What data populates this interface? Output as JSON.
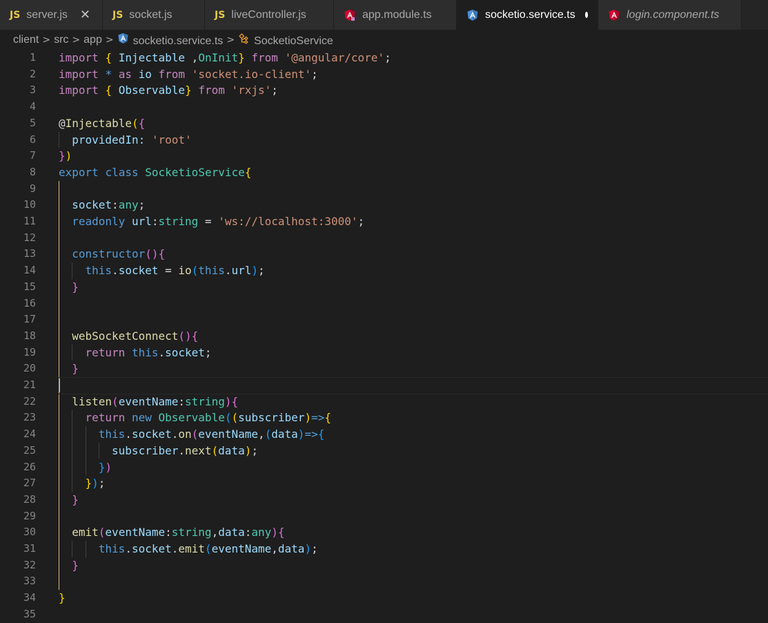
{
  "tabs": [
    {
      "label": "server.js",
      "icon": "js-icon",
      "icon_text": "JS",
      "active": false,
      "italic": false,
      "close": true,
      "dirty": false
    },
    {
      "label": "socket.js",
      "icon": "js-icon",
      "icon_text": "JS",
      "active": false,
      "italic": false,
      "close": false,
      "dirty": false
    },
    {
      "label": "liveController.js",
      "icon": "js-icon",
      "icon_text": "JS",
      "active": false,
      "italic": false,
      "close": false,
      "dirty": false
    },
    {
      "label": "app.module.ts",
      "icon": "angular-module-icon",
      "icon_text": "",
      "active": false,
      "italic": false,
      "close": false,
      "dirty": false
    },
    {
      "label": "socketio.service.ts",
      "icon": "angular-service-icon",
      "icon_text": "",
      "active": true,
      "italic": false,
      "close": false,
      "dirty": true
    },
    {
      "label": "login.component.ts",
      "icon": "angular-component-icon",
      "icon_text": "",
      "active": false,
      "italic": true,
      "close": false,
      "dirty": false
    }
  ],
  "breadcrumb": {
    "segments": [
      "client",
      "src",
      "app",
      "socketio.service.ts",
      "SocketioService"
    ],
    "separator": ">"
  },
  "colors": {
    "keyword": "#569cd6",
    "control": "#c586c0",
    "function": "#dcdcaa",
    "type": "#4ec9b0",
    "variable": "#9cdcfe",
    "string": "#ce9178",
    "punct": "#d4d4d4",
    "bracket1": "#ffd700",
    "bracket2": "#da70d6",
    "bracket3": "#179fff",
    "js_icon": "#e6c84a",
    "angular_red": "#dd0031",
    "angular_blue": "#4a90d9"
  },
  "editor": {
    "active_line": 21,
    "lines": [
      {
        "n": "1",
        "indent": 0,
        "tokens": [
          [
            "ctl",
            "import"
          ],
          [
            "p",
            " "
          ],
          [
            "b1",
            "{"
          ],
          [
            "p",
            " "
          ],
          [
            "var",
            "Injectable"
          ],
          [
            "p",
            " ,"
          ],
          [
            "type",
            "OnInit"
          ],
          [
            "b1",
            "}"
          ],
          [
            "p",
            " "
          ],
          [
            "ctl",
            "from"
          ],
          [
            "p",
            " "
          ],
          [
            "str",
            "'@angular/core'"
          ],
          [
            "p",
            ";"
          ]
        ]
      },
      {
        "n": "2",
        "indent": 0,
        "tokens": [
          [
            "ctl",
            "import"
          ],
          [
            "p",
            " "
          ],
          [
            "kw",
            "*"
          ],
          [
            "p",
            " "
          ],
          [
            "ctl",
            "as"
          ],
          [
            "p",
            " "
          ],
          [
            "var",
            "io"
          ],
          [
            "p",
            " "
          ],
          [
            "ctl",
            "from"
          ],
          [
            "p",
            " "
          ],
          [
            "str",
            "'socket.io-client'"
          ],
          [
            "p",
            ";"
          ]
        ]
      },
      {
        "n": "3",
        "indent": 0,
        "tokens": [
          [
            "ctl",
            "import"
          ],
          [
            "p",
            " "
          ],
          [
            "b1",
            "{"
          ],
          [
            "p",
            " "
          ],
          [
            "var",
            "Observable"
          ],
          [
            "b1",
            "}"
          ],
          [
            "p",
            " "
          ],
          [
            "ctl",
            "from"
          ],
          [
            "p",
            " "
          ],
          [
            "str",
            "'rxjs'"
          ],
          [
            "p",
            ";"
          ]
        ]
      },
      {
        "n": "4",
        "indent": 0,
        "tokens": []
      },
      {
        "n": "5",
        "indent": 0,
        "tokens": [
          [
            "p",
            "@"
          ],
          [
            "fn",
            "Injectable"
          ],
          [
            "b1",
            "("
          ],
          [
            "b2",
            "{"
          ]
        ]
      },
      {
        "n": "6",
        "indent": 1,
        "tokens": [
          [
            "var",
            "providedIn"
          ],
          [
            "var",
            ":"
          ],
          [
            "p",
            " "
          ],
          [
            "str",
            "'root'"
          ]
        ]
      },
      {
        "n": "7",
        "indent": 0,
        "tokens": [
          [
            "b2",
            "}"
          ],
          [
            "b1",
            ")"
          ]
        ]
      },
      {
        "n": "8",
        "indent": 0,
        "tokens": [
          [
            "kw",
            "export"
          ],
          [
            "p",
            " "
          ],
          [
            "kw",
            "class"
          ],
          [
            "p",
            " "
          ],
          [
            "type",
            "SocketioService"
          ],
          [
            "b1",
            "{"
          ]
        ]
      },
      {
        "n": "9",
        "indent": 0,
        "tokens": []
      },
      {
        "n": "10",
        "indent": 1,
        "tokens": [
          [
            "var",
            "socket"
          ],
          [
            "p",
            ":"
          ],
          [
            "type",
            "any"
          ],
          [
            "p",
            ";"
          ]
        ]
      },
      {
        "n": "11",
        "indent": 1,
        "tokens": [
          [
            "kw",
            "readonly"
          ],
          [
            "p",
            " "
          ],
          [
            "var",
            "url"
          ],
          [
            "p",
            ":"
          ],
          [
            "type",
            "string"
          ],
          [
            "p",
            " = "
          ],
          [
            "str",
            "'ws://localhost:3000'"
          ],
          [
            "p",
            ";"
          ]
        ]
      },
      {
        "n": "12",
        "indent": 0,
        "tokens": []
      },
      {
        "n": "13",
        "indent": 1,
        "tokens": [
          [
            "kw",
            "constructor"
          ],
          [
            "b2",
            "()"
          ],
          [
            "b2",
            "{"
          ]
        ]
      },
      {
        "n": "14",
        "indent": 2,
        "tokens": [
          [
            "kw",
            "this"
          ],
          [
            "p",
            "."
          ],
          [
            "var",
            "socket"
          ],
          [
            "p",
            " = "
          ],
          [
            "fn",
            "io"
          ],
          [
            "b3",
            "("
          ],
          [
            "kw",
            "this"
          ],
          [
            "p",
            "."
          ],
          [
            "var",
            "url"
          ],
          [
            "b3",
            ")"
          ],
          [
            "p",
            ";"
          ]
        ]
      },
      {
        "n": "15",
        "indent": 1,
        "tokens": [
          [
            "b2",
            "}"
          ]
        ]
      },
      {
        "n": "16",
        "indent": 0,
        "tokens": []
      },
      {
        "n": "17",
        "indent": 0,
        "tokens": []
      },
      {
        "n": "18",
        "indent": 1,
        "tokens": [
          [
            "fn",
            "webSocketConnect"
          ],
          [
            "b2",
            "()"
          ],
          [
            "b2",
            "{"
          ]
        ]
      },
      {
        "n": "19",
        "indent": 2,
        "tokens": [
          [
            "ctl",
            "return"
          ],
          [
            "p",
            " "
          ],
          [
            "kw",
            "this"
          ],
          [
            "p",
            "."
          ],
          [
            "var",
            "socket"
          ],
          [
            "p",
            ";"
          ]
        ]
      },
      {
        "n": "20",
        "indent": 1,
        "tokens": [
          [
            "b2",
            "}"
          ]
        ]
      },
      {
        "n": "21",
        "indent": 0,
        "tokens": []
      },
      {
        "n": "22",
        "indent": 1,
        "tokens": [
          [
            "fn",
            "listen"
          ],
          [
            "b2",
            "("
          ],
          [
            "var",
            "eventName"
          ],
          [
            "p",
            ":"
          ],
          [
            "type",
            "string"
          ],
          [
            "b2",
            ")"
          ],
          [
            "b2",
            "{"
          ]
        ]
      },
      {
        "n": "23",
        "indent": 2,
        "tokens": [
          [
            "ctl",
            "return"
          ],
          [
            "p",
            " "
          ],
          [
            "kw",
            "new"
          ],
          [
            "p",
            " "
          ],
          [
            "type",
            "Observable"
          ],
          [
            "b3",
            "("
          ],
          [
            "b1",
            "("
          ],
          [
            "var",
            "subscriber"
          ],
          [
            "b1",
            ")"
          ],
          [
            "kw",
            "=>"
          ],
          [
            "b1",
            "{"
          ]
        ]
      },
      {
        "n": "24",
        "indent": 3,
        "tokens": [
          [
            "kw",
            "this"
          ],
          [
            "p",
            "."
          ],
          [
            "var",
            "socket"
          ],
          [
            "p",
            "."
          ],
          [
            "fn",
            "on"
          ],
          [
            "b2",
            "("
          ],
          [
            "var",
            "eventName"
          ],
          [
            "p",
            ","
          ],
          [
            "b3",
            "("
          ],
          [
            "var",
            "data"
          ],
          [
            "b3",
            ")"
          ],
          [
            "kw",
            "=>"
          ],
          [
            "b3",
            "{"
          ]
        ]
      },
      {
        "n": "25",
        "indent": 4,
        "tokens": [
          [
            "var",
            "subscriber"
          ],
          [
            "p",
            "."
          ],
          [
            "fn",
            "next"
          ],
          [
            "b1",
            "("
          ],
          [
            "var",
            "data"
          ],
          [
            "b1",
            ")"
          ],
          [
            "p",
            ";"
          ]
        ]
      },
      {
        "n": "26",
        "indent": 3,
        "tokens": [
          [
            "b3",
            "}"
          ],
          [
            "b2",
            ")"
          ]
        ]
      },
      {
        "n": "27",
        "indent": 2,
        "tokens": [
          [
            "b1",
            "}"
          ],
          [
            "b3",
            ")"
          ],
          [
            "p",
            ";"
          ]
        ]
      },
      {
        "n": "28",
        "indent": 1,
        "tokens": [
          [
            "b2",
            "}"
          ]
        ]
      },
      {
        "n": "29",
        "indent": 0,
        "tokens": []
      },
      {
        "n": "30",
        "indent": 1,
        "tokens": [
          [
            "fn",
            "emit"
          ],
          [
            "b2",
            "("
          ],
          [
            "var",
            "eventName"
          ],
          [
            "p",
            ":"
          ],
          [
            "type",
            "string"
          ],
          [
            "p",
            ","
          ],
          [
            "var",
            "data"
          ],
          [
            "p",
            ":"
          ],
          [
            "type",
            "any"
          ],
          [
            "b2",
            ")"
          ],
          [
            "b2",
            "{"
          ]
        ]
      },
      {
        "n": "31",
        "indent": 2,
        "tokens": [
          [
            "p",
            "  "
          ],
          [
            "kw",
            "this"
          ],
          [
            "p",
            "."
          ],
          [
            "var",
            "socket"
          ],
          [
            "p",
            "."
          ],
          [
            "fn",
            "emit"
          ],
          [
            "b3",
            "("
          ],
          [
            "var",
            "eventName"
          ],
          [
            "p",
            ","
          ],
          [
            "var",
            "data"
          ],
          [
            "b3",
            ")"
          ],
          [
            "p",
            ";"
          ]
        ]
      },
      {
        "n": "32",
        "indent": 1,
        "tokens": [
          [
            "b2",
            "}"
          ]
        ]
      },
      {
        "n": "33",
        "indent": 0,
        "tokens": []
      },
      {
        "n": "34",
        "indent": 0,
        "tokens": [
          [
            "b1",
            "}"
          ]
        ]
      },
      {
        "n": "35",
        "indent": 0,
        "tokens": []
      }
    ]
  }
}
